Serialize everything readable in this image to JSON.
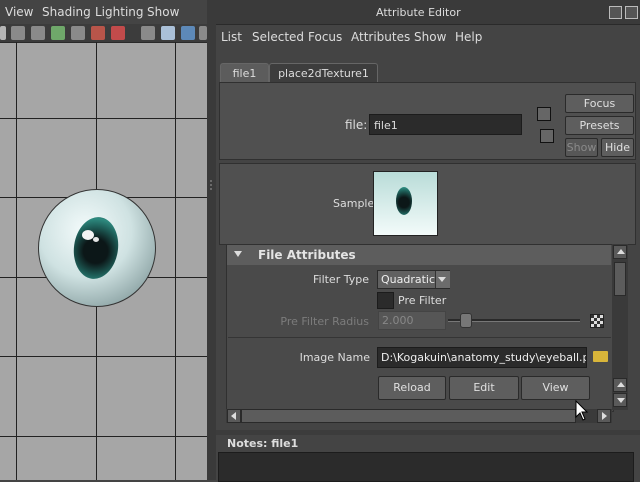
{
  "viewport": {
    "menu": [
      "View",
      "Shading",
      "Lighting",
      "Show"
    ]
  },
  "attribute_editor": {
    "title": "Attribute Editor",
    "menu": [
      "List",
      "Selected",
      "Focus",
      "Attributes",
      "Show",
      "Help"
    ],
    "tabs": [
      {
        "label": "file1",
        "active": true
      },
      {
        "label": "place2dTexture1",
        "active": false
      }
    ],
    "node": {
      "label": "file:",
      "value": "file1"
    },
    "buttons": {
      "focus": "Focus",
      "presets": "Presets",
      "show": "Show",
      "hide": "Hide"
    },
    "sample_label": "Sample",
    "file_attributes": {
      "title": "File Attributes",
      "filter_type_label": "Filter Type",
      "filter_type_value": "Quadratic",
      "pre_filter_label": "Pre Filter",
      "pre_filter_radius_label": "Pre Filter Radius",
      "pre_filter_radius_value": "2.000",
      "image_name_label": "Image Name",
      "image_name_value": "D:\\Kogakuin\\anatomy_study\\eyeball.png",
      "reload": "Reload",
      "edit": "Edit",
      "view": "View"
    },
    "notes_label": "Notes:  file1"
  },
  "colors": {
    "panel_bg": "#444444",
    "viewport_bg": "#a6a6a6",
    "field_bg": "#2b2b2b",
    "iris": "#1e5e58"
  },
  "icons": [
    "maximize-icon",
    "close-icon",
    "folder-icon",
    "checker-icon",
    "node-input-icon",
    "node-output-icon"
  ]
}
